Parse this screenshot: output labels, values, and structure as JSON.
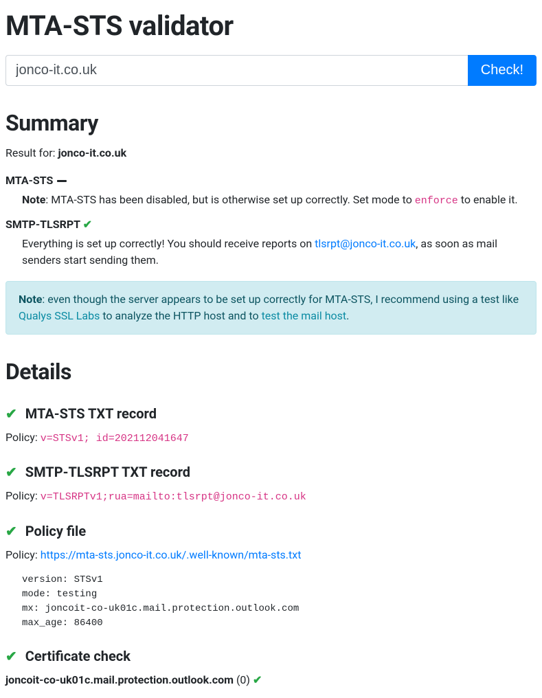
{
  "title": "MTA-STS validator",
  "input": {
    "value": "jonco-it.co.uk"
  },
  "check_button": "Check!",
  "summary": {
    "heading": "Summary",
    "result_prefix": "Result for: ",
    "domain": "jonco-it.co.uk",
    "mtasts": {
      "label": "MTA-STS",
      "note_label": "Note",
      "note_sep": ": ",
      "note_before": "MTA-STS has been disabled, but is otherwise set up correctly. Set mode to ",
      "note_code": "enforce",
      "note_after": " to enable it."
    },
    "tlsrpt": {
      "label": "SMTP-TLSRPT",
      "check": "✔",
      "msg_before": "Everything is set up correctly! You should receive reports on ",
      "email": "tlsrpt@jonco-it.co.uk",
      "msg_after": ", as soon as mail senders start sending them."
    },
    "alert": {
      "note_label": "Note",
      "sep": ": ",
      "t1": "even though the server appears to be set up correctly for MTA-STS, I recommend using a test like ",
      "link1": "Qualys SSL Labs",
      "t2": " to analyze the HTTP host and to ",
      "link2": "test the mail host",
      "t3": "."
    }
  },
  "details": {
    "heading": "Details",
    "check": "✔",
    "sections": {
      "txt": {
        "title": "MTA-STS TXT record",
        "policy_label": "Policy: ",
        "policy_value": "v=STSv1; id=202112041647"
      },
      "tlsrpt_txt": {
        "title": "SMTP-TLSRPT TXT record",
        "policy_label": "Policy: ",
        "policy_value": "v=TLSRPTv1;rua=mailto:tlsrpt@jonco-it.co.uk"
      },
      "policy_file": {
        "title": "Policy file",
        "policy_label": "Policy: ",
        "policy_url": "https://mta-sts.jonco-it.co.uk/.well-known/mta-sts.txt",
        "policy_body": "version: STSv1\nmode: testing\nmx: joncoit-co-uk01c.mail.protection.outlook.com\nmax_age: 86400"
      },
      "cert": {
        "title": "Certificate check",
        "host": "joncoit-co-uk01c.mail.protection.outlook.com",
        "count": " (0) ",
        "check": "✔"
      }
    }
  }
}
